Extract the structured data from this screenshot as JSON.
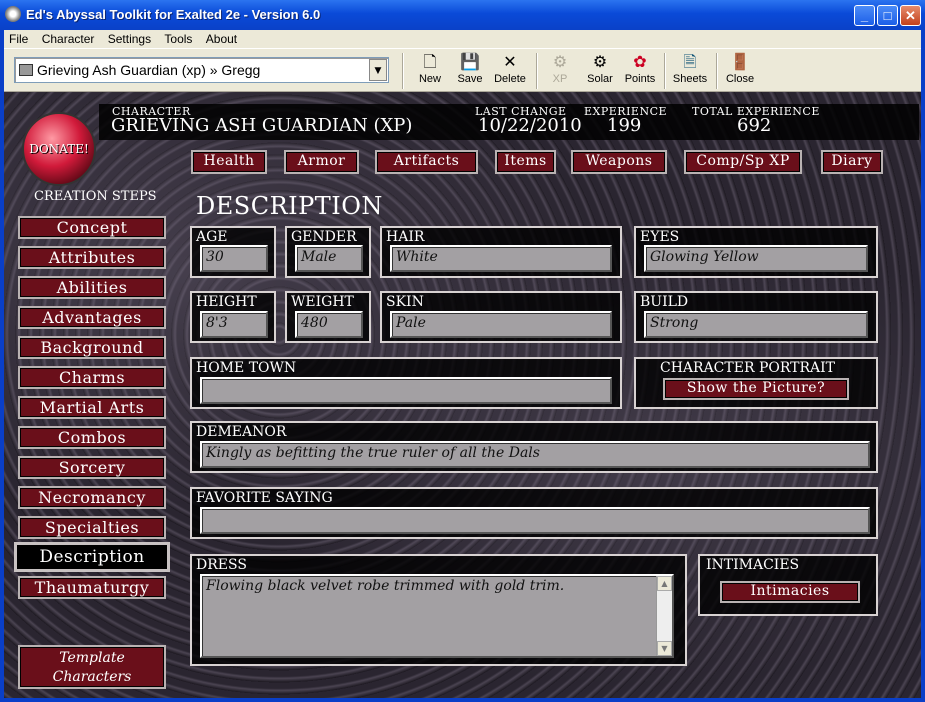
{
  "window": {
    "title": "Ed's Abyssal Toolkit for Exalted 2e - Version 6.0"
  },
  "menu": [
    "File",
    "Character",
    "Settings",
    "Tools",
    "About"
  ],
  "toolbar": {
    "combo_value": "Grieving Ash Guardian (xp) » Gregg",
    "buttons": [
      {
        "label": "New",
        "icon": "new-document-icon",
        "enabled": true
      },
      {
        "label": "Save",
        "icon": "save-disk-icon",
        "enabled": true
      },
      {
        "label": "Delete",
        "icon": "delete-x-icon",
        "enabled": true
      },
      {
        "label": "XP",
        "icon": "xp-icon",
        "enabled": false
      },
      {
        "label": "Solar",
        "icon": "solar-icon",
        "enabled": true
      },
      {
        "label": "Points",
        "icon": "points-icon",
        "enabled": true
      },
      {
        "label": "Sheets",
        "icon": "sheets-icon",
        "enabled": true
      },
      {
        "label": "Close",
        "icon": "close-door-icon",
        "enabled": true
      }
    ]
  },
  "header": {
    "character_label": "CHARACTER",
    "character_name": "GRIEVING ASH GUARDIAN (XP)",
    "last_change_label": "LAST CHANGE",
    "last_change": "10/22/2010",
    "experience_label": "EXPERIENCE",
    "experience": "199",
    "total_experience_label": "TOTAL EXPERIENCE",
    "total_experience": "692"
  },
  "donate_label": "DONATE!",
  "tabs": [
    "Health",
    "Armor",
    "Artifacts",
    "Items",
    "Weapons",
    "Comp/Sp XP",
    "Diary"
  ],
  "steps_title": "CREATION STEPS",
  "steps": [
    "Concept",
    "Attributes",
    "Abilities",
    "Advantages",
    "Background",
    "Charms",
    "Martial Arts",
    "Combos",
    "Sorcery",
    "Necromancy",
    "Specialties",
    "Description",
    "Thaumaturgy"
  ],
  "active_step": "Description",
  "template_button": [
    "Template",
    "Characters"
  ],
  "section_title": "DESCRIPTION",
  "fields": {
    "age": {
      "label": "AGE",
      "value": "30"
    },
    "gender": {
      "label": "GENDER",
      "value": "Male"
    },
    "hair": {
      "label": "HAIR",
      "value": "White"
    },
    "eyes": {
      "label": "EYES",
      "value": "Glowing Yellow"
    },
    "height": {
      "label": "HEIGHT",
      "value": "8'3"
    },
    "weight": {
      "label": "WEIGHT",
      "value": "480"
    },
    "skin": {
      "label": "SKIN",
      "value": "Pale"
    },
    "build": {
      "label": "BUILD",
      "value": "Strong"
    },
    "home_town": {
      "label": "HOME TOWN",
      "value": ""
    },
    "demeanor": {
      "label": "DEMEANOR",
      "value": "Kingly as befitting the true ruler of all the Dals"
    },
    "favorite_saying": {
      "label": "FAVORITE SAYING",
      "value": ""
    },
    "dress": {
      "label": "DRESS",
      "value": "Flowing black velvet robe trimmed with gold trim."
    }
  },
  "portrait": {
    "label": "CHARACTER PORTRAIT",
    "button": "Show the Picture?"
  },
  "intimacies": {
    "label": "INTIMACIES",
    "button": "Intimacies"
  },
  "colors": {
    "titlebar": "#0a4ad8",
    "button_bg": "#6a0f1a",
    "chrome": "#ece9d8",
    "input_bg": "#a3a0a3"
  }
}
